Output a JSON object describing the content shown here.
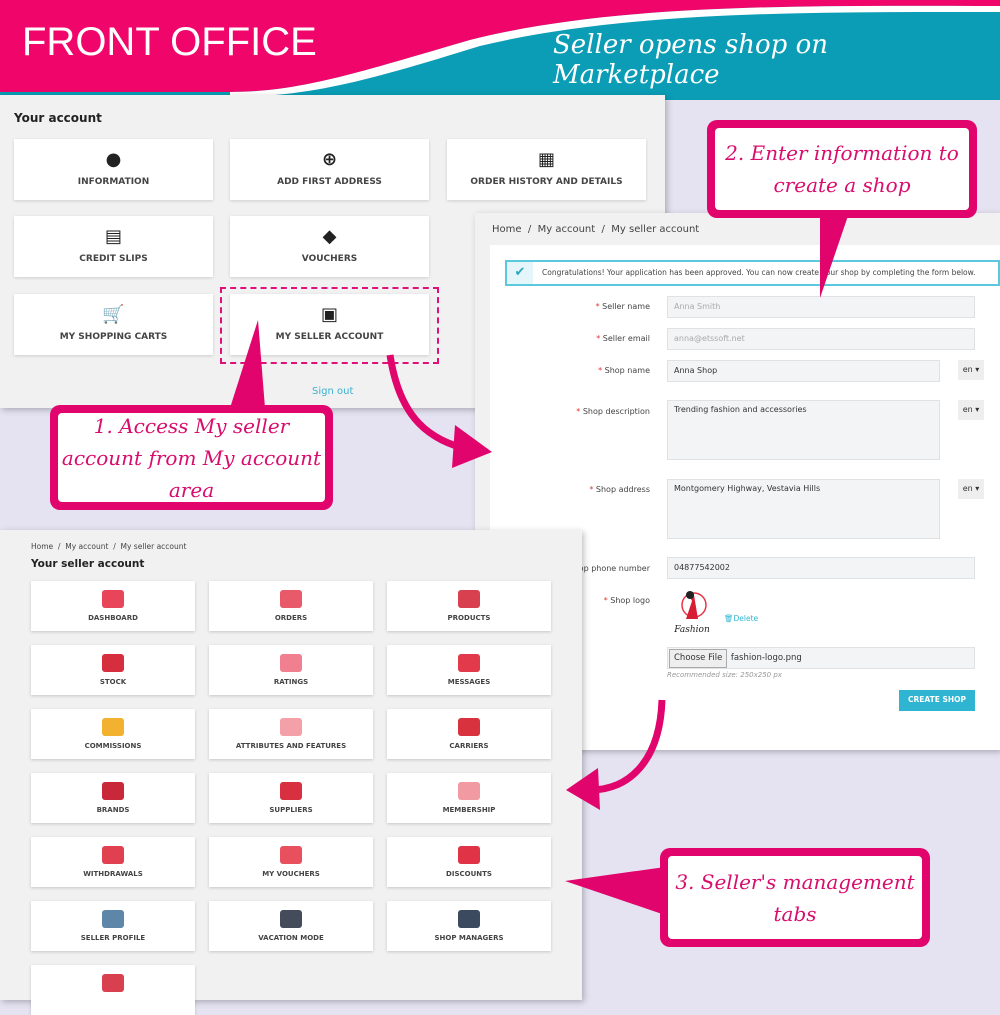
{
  "header": {
    "left_title": "FRONT OFFICE",
    "right_title": "Seller opens shop on Marketplace",
    "colors": {
      "pink": "#f0066a",
      "teal": "#0a9db5"
    }
  },
  "account": {
    "title": "Your account",
    "tiles": [
      {
        "label": "INFORMATION",
        "icon": "user-circle-icon",
        "glyph": "●"
      },
      {
        "label": "ADD FIRST ADDRESS",
        "icon": "map-pin-plus-icon",
        "glyph": "⊕"
      },
      {
        "label": "ORDER HISTORY AND DETAILS",
        "icon": "calendar-icon",
        "glyph": "▦"
      },
      {
        "label": "CREDIT SLIPS",
        "icon": "receipt-icon",
        "glyph": "▤"
      },
      {
        "label": "VOUCHERS",
        "icon": "tag-icon",
        "glyph": "◆"
      },
      {
        "label": "MY SHOPPING CARTS",
        "icon": "cart-icon",
        "glyph": "🛒"
      },
      {
        "label": "MY SELLER ACCOUNT",
        "icon": "basket-icon",
        "glyph": "▣"
      }
    ],
    "sign_out": "Sign out"
  },
  "callouts": {
    "c1": "1. Access My seller account from My account area",
    "c2": "2. Enter information to create a shop",
    "c3": "3. Seller's management tabs"
  },
  "form": {
    "breadcrumb": [
      "Home",
      "My account",
      "My seller account"
    ],
    "alert": "Congratulations! Your application has been approved. You can now create your shop by completing the form below.",
    "fields": {
      "seller_name": {
        "label": "Seller name",
        "value": "Anna Smith"
      },
      "seller_email": {
        "label": "Seller email",
        "value": "anna@etssoft.net"
      },
      "shop_name": {
        "label": "Shop name",
        "value": "Anna Shop",
        "lang": "en ▾"
      },
      "shop_description": {
        "label": "Shop description",
        "value": "Trending fashion and accessories",
        "lang": "en ▾"
      },
      "shop_address": {
        "label": "Shop address",
        "value": "Montgomery Highway, Vestavia Hills",
        "lang": "en ▾"
      },
      "shop_phone": {
        "label": "op phone number",
        "value": "04877542002"
      },
      "shop_logo": {
        "label": "Shop logo",
        "logo_text": "Fashion",
        "delete": "Delete",
        "choose_file": "Choose File",
        "file_name": "fashion-logo.png",
        "hint": "Recommended size: 250x250 px"
      }
    },
    "submit": "CREATE SHOP"
  },
  "seller": {
    "breadcrumb": [
      "Home",
      "My account",
      "My seller account"
    ],
    "title": "Your seller account",
    "tiles": [
      {
        "label": "DASHBOARD",
        "icon": "dashboard-icon",
        "color": "#e8455a"
      },
      {
        "label": "ORDERS",
        "icon": "orders-icon",
        "color": "#e85a6a"
      },
      {
        "label": "PRODUCTS",
        "icon": "products-icon",
        "color": "#d8404f"
      },
      {
        "label": "STOCK",
        "icon": "stock-icon",
        "color": "#d62d3f"
      },
      {
        "label": "RATINGS",
        "icon": "ratings-icon",
        "color": "#f08090"
      },
      {
        "label": "MESSAGES",
        "icon": "messages-icon",
        "color": "#e23a4a"
      },
      {
        "label": "COMMISSIONS",
        "icon": "commissions-icon",
        "color": "#f2b230"
      },
      {
        "label": "ATTRIBUTES AND FEATURES",
        "icon": "attributes-icon",
        "color": "#f3a0a8"
      },
      {
        "label": "CARRIERS",
        "icon": "carriers-icon",
        "color": "#d8323f"
      },
      {
        "label": "BRANDS",
        "icon": "brands-icon",
        "color": "#c8283a"
      },
      {
        "label": "SUPPLIERS",
        "icon": "suppliers-icon",
        "color": "#d83040"
      },
      {
        "label": "MEMBERSHIP",
        "icon": "membership-icon",
        "color": "#f29aa2"
      },
      {
        "label": "WITHDRAWALS",
        "icon": "withdrawals-icon",
        "color": "#e04050"
      },
      {
        "label": "MY VOUCHERS",
        "icon": "vouchers-icon",
        "color": "#e8505e"
      },
      {
        "label": "DISCOUNTS",
        "icon": "discounts-icon",
        "color": "#e03446"
      },
      {
        "label": "SELLER PROFILE",
        "icon": "seller-profile-icon",
        "color": "#5d86a8"
      },
      {
        "label": "VACATION MODE",
        "icon": "vacation-icon",
        "color": "#444c5c"
      },
      {
        "label": "SHOP MANAGERS",
        "icon": "shop-managers-icon",
        "color": "#3b4a5e"
      },
      {
        "label": "",
        "icon": "shop-icon",
        "color": "#d84050"
      }
    ]
  }
}
